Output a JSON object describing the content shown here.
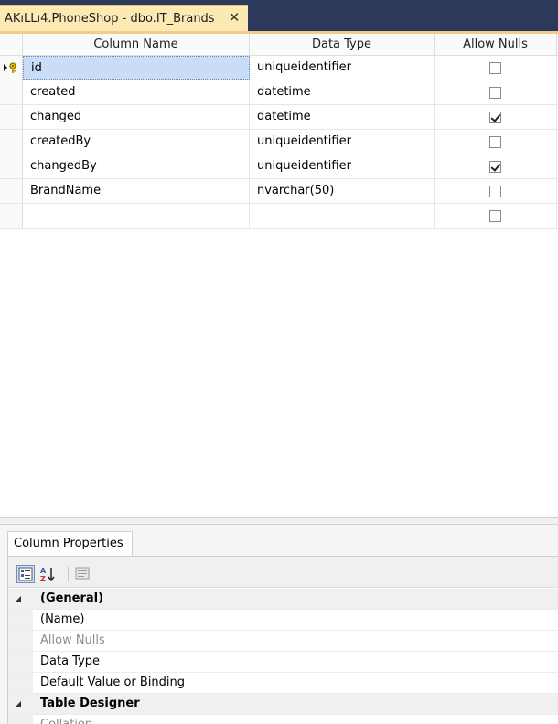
{
  "window": {
    "tab_title": "AKıLLı4.PhoneShop - dbo.IT_Brands",
    "close_glyph": "✕"
  },
  "grid": {
    "columns": [
      "Column Name",
      "Data Type",
      "Allow Nulls"
    ],
    "rows": [
      {
        "name": "id",
        "type": "uniqueidentifier",
        "allow_nulls": false,
        "primary_key": true,
        "active": true
      },
      {
        "name": "created",
        "type": "datetime",
        "allow_nulls": false
      },
      {
        "name": "changed",
        "type": "datetime",
        "allow_nulls": true
      },
      {
        "name": "createdBy",
        "type": "uniqueidentifier",
        "allow_nulls": false
      },
      {
        "name": "changedBy",
        "type": "uniqueidentifier",
        "allow_nulls": true
      },
      {
        "name": "BrandName",
        "type": "nvarchar(50)",
        "allow_nulls": false
      },
      {
        "name": "",
        "type": "",
        "allow_nulls": false
      }
    ]
  },
  "properties": {
    "tab_label": "Column Properties",
    "toolbar": {
      "categorized_icon": "categorized-icon",
      "alphabetical_icon": "sort-az-icon",
      "pages_icon": "property-pages-icon"
    },
    "rows": [
      {
        "label": "(General)",
        "category": true
      },
      {
        "label": "(Name)",
        "category": false,
        "dim": false
      },
      {
        "label": "Allow Nulls",
        "category": false,
        "dim": true
      },
      {
        "label": "Data Type",
        "category": false,
        "dim": false
      },
      {
        "label": "Default Value or Binding",
        "category": false,
        "dim": false
      },
      {
        "label": "Table Designer",
        "category": true
      },
      {
        "label": "Collation",
        "category": false,
        "dim": true
      }
    ]
  },
  "colors": {
    "tab_active": "#fde9b3",
    "tabstrip_bg": "#2b3a5b",
    "selection": "#c9ddf6"
  }
}
